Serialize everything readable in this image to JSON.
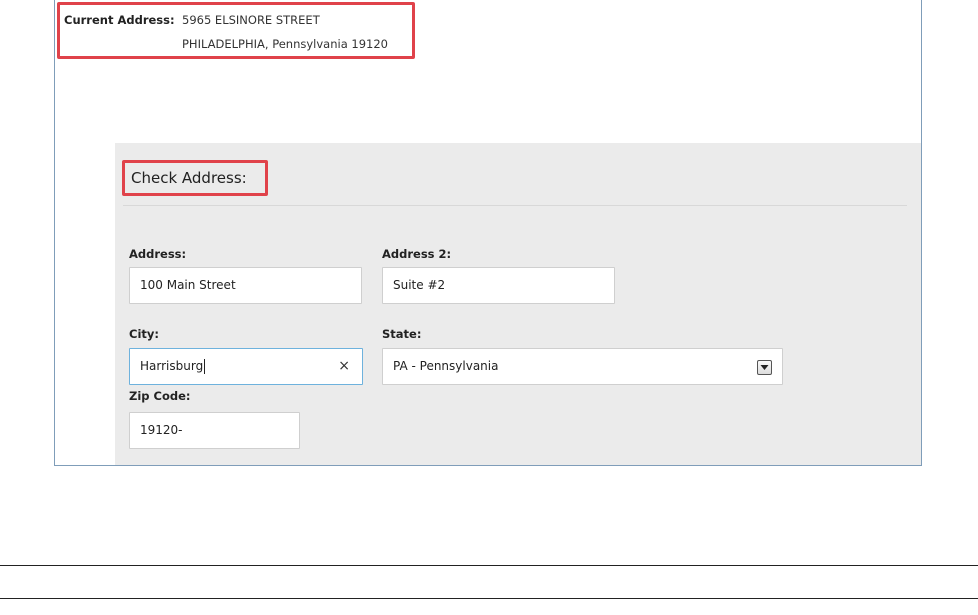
{
  "current_address": {
    "label": "Current Address:",
    "line1": "5965 ELSINORE STREET",
    "line2": "PHILADELPHIA, Pennsylvania 19120"
  },
  "check_address": {
    "title": "Check Address:"
  },
  "form": {
    "address": {
      "label": "Address:",
      "value": "100 Main Street"
    },
    "address2": {
      "label": "Address 2:",
      "value": "Suite #2"
    },
    "city": {
      "label": "City:",
      "value": "Harrisburg",
      "clear": "×"
    },
    "state": {
      "label": "State:",
      "value": "PA - Pennsylvania"
    },
    "zip": {
      "label": "Zip Code:",
      "value": "19120-"
    }
  },
  "colors": {
    "highlight": "#e0424a",
    "panel_bg": "#ebebeb",
    "focus_border": "#6eb2dd"
  }
}
